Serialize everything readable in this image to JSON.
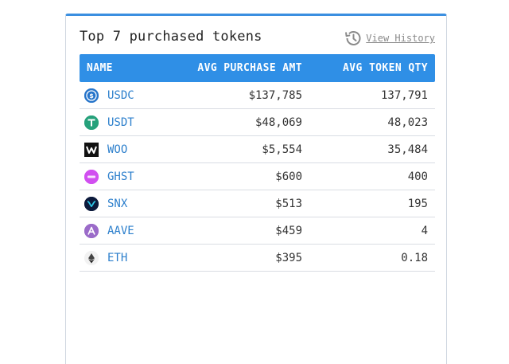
{
  "card": {
    "title": "Top 7 purchased tokens",
    "history_label": "View History"
  },
  "table": {
    "headers": [
      "NAME",
      "AVG PURCHASE AMT",
      "AVG TOKEN QTY"
    ],
    "rows": [
      {
        "symbol": "USDC",
        "amt": "$137,785",
        "qty": "137,791",
        "icon": "usdc-icon",
        "icon_color": "#2775ca"
      },
      {
        "symbol": "USDT",
        "amt": "$48,069",
        "qty": "48,023",
        "icon": "usdt-icon",
        "icon_color": "#26a17b"
      },
      {
        "symbol": "WOO",
        "amt": "$5,554",
        "qty": "35,484",
        "icon": "woo-icon",
        "icon_color": "#111111"
      },
      {
        "symbol": "GHST",
        "amt": "$600",
        "qty": "400",
        "icon": "ghst-icon",
        "icon_color": "#d14ff0"
      },
      {
        "symbol": "SNX",
        "amt": "$513",
        "qty": "195",
        "icon": "snx-icon",
        "icon_color": "#0c1a3c"
      },
      {
        "symbol": "AAVE",
        "amt": "$459",
        "qty": "4",
        "icon": "aave-icon",
        "icon_color": "#9b6bc9"
      },
      {
        "symbol": "ETH",
        "amt": "$395",
        "qty": "0.18",
        "icon": "eth-icon",
        "icon_color": "#f2f2f2"
      }
    ]
  },
  "colors": {
    "accent": "#2f8fe6",
    "link": "#2c7fcc"
  }
}
